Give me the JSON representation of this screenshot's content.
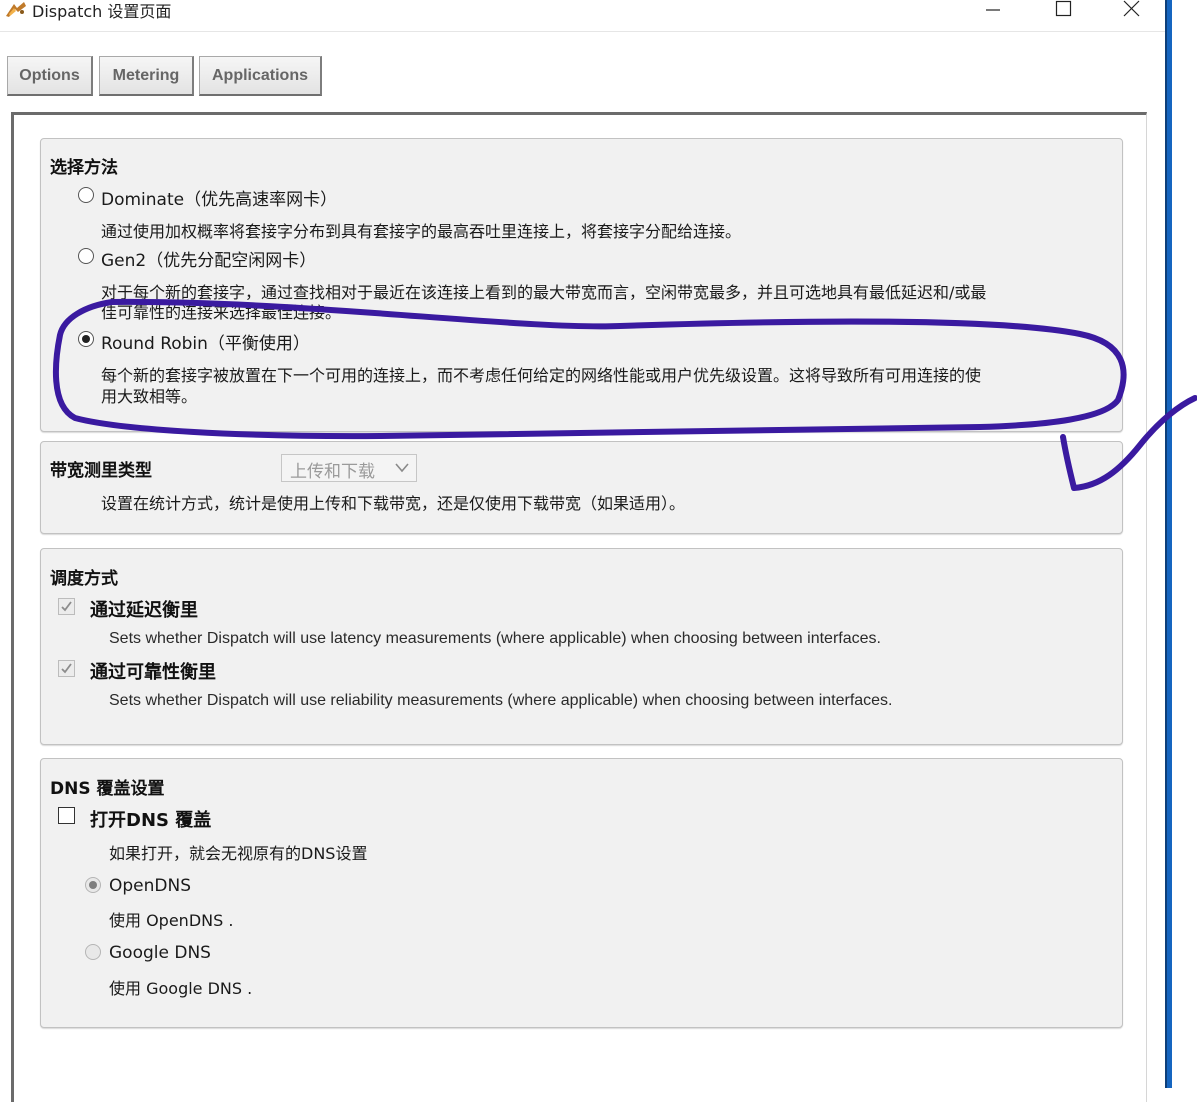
{
  "window": {
    "title": "Dispatch 设置页面",
    "app_icon": "dispatch-app-icon",
    "controls": [
      "minimize-icon",
      "maximize-icon",
      "close-icon"
    ]
  },
  "tabs": [
    {
      "label": "Options"
    },
    {
      "label": "Metering"
    },
    {
      "label": "Applications"
    }
  ],
  "selection_method": {
    "heading": "选择方法",
    "options": [
      {
        "label": "Dominate（优先高速率网卡）",
        "checked": false,
        "description": "通过使用加权概率将套接字分布到具有套接字的最高吞吐里连接上，将套接字分配给连接。"
      },
      {
        "label": "Gen2（优先分配空闲网卡）",
        "checked": false,
        "description_line1": "对于每个新的套接字，通过查找相对于最近在该连接上看到的最大带宽而言，空闲带宽最多，并且可选地具有最低延迟和/或最",
        "description_line2": "佳可靠性的连接来选择最佳连接。"
      },
      {
        "label": "Round Robin（平衡使用）",
        "checked": true,
        "description_line1": "每个新的套接字被放置在下一个可用的连接上，而不考虑任何给定的网络性能或用户优先级设置。这将导致所有可用连接的使",
        "description_line2": "用大致相等。"
      }
    ]
  },
  "bandwidth": {
    "heading": "带宽测里类型",
    "select_value": "上传和下载",
    "description": "设置在统计方式，统计是使用上传和下载带宽，还是仅使用下载带宽（如果适用）。"
  },
  "scheduling": {
    "heading": "调度方式",
    "items": [
      {
        "label": "通过延迟衡里",
        "checked": true,
        "description": "Sets whether Dispatch will use latency measurements (where applicable) when choosing between interfaces."
      },
      {
        "label": "通过可靠性衡里",
        "checked": true,
        "description": "Sets whether Dispatch will use reliability measurements (where applicable) when choosing between interfaces."
      }
    ]
  },
  "dns": {
    "heading": "DNS 覆盖设置",
    "toggle_label": "打开DNS 覆盖",
    "toggle_checked": false,
    "toggle_description": "如果打开，就会无视原有的DNS设置",
    "options": [
      {
        "label": "OpenDNS",
        "description": "使用 OpenDNS .",
        "checked": true
      },
      {
        "label": "Google DNS",
        "description": "使用 Google DNS .",
        "checked": false
      }
    ]
  },
  "colors": {
    "annotation_stroke": "#3a1aa0",
    "panel_bg": "#f1f1f1",
    "taskbar_blue": "#1565c0"
  }
}
